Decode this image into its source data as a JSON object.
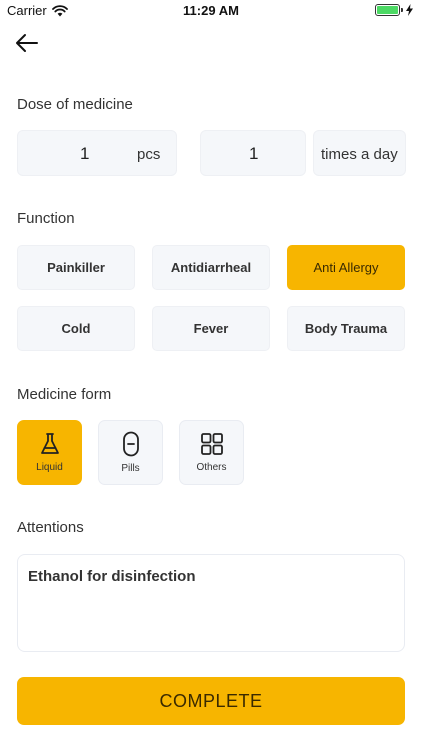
{
  "status_bar": {
    "carrier": "Carrier",
    "time": "11:29 AM",
    "battery_level": 1.0
  },
  "dose": {
    "label": "Dose of medicine",
    "quantity": "1",
    "quantity_unit": "pcs",
    "frequency": "1",
    "frequency_unit": "times a day"
  },
  "function": {
    "label": "Function",
    "options": [
      "Painkiller",
      "Antidiarrheal",
      "Anti Allergy",
      "Cold",
      "Fever",
      "Body Trauma"
    ],
    "selected": "Anti Allergy"
  },
  "medicine_form": {
    "label": "Medicine form",
    "options": [
      {
        "label": "Liquid",
        "icon": "flask-icon"
      },
      {
        "label": "Pills",
        "icon": "pill-icon"
      },
      {
        "label": "Others",
        "icon": "grid-icon"
      }
    ],
    "selected": "Liquid"
  },
  "attentions": {
    "label": "Attentions",
    "value": "Ethanol for disinfection"
  },
  "complete_button": "COMPLETE",
  "colors": {
    "accent": "#f7b500",
    "box_bg": "#f5f7fa"
  }
}
